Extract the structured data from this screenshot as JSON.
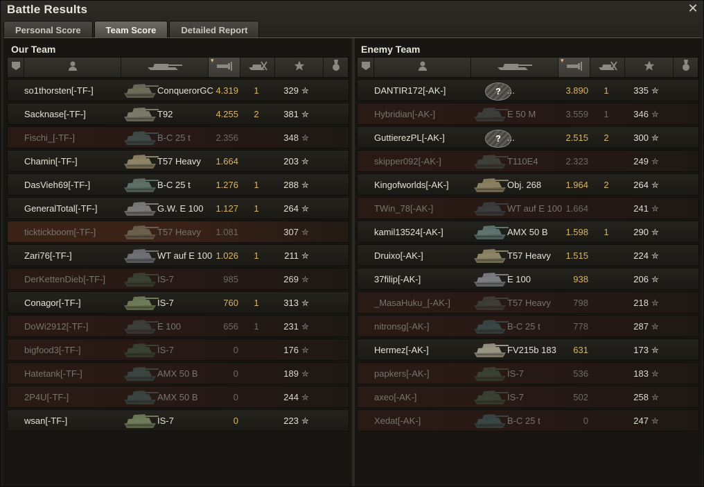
{
  "window": {
    "title": "Battle Results",
    "close_label": "✕"
  },
  "tabs": [
    {
      "label": "Personal Score",
      "active": false
    },
    {
      "label": "Team Score",
      "active": true
    },
    {
      "label": "Detailed Report",
      "active": false
    }
  ],
  "headers": {
    "icons": [
      "platoon-icon",
      "player-icon",
      "tank-icon",
      "damage-icon",
      "frags-icon",
      "xp-star-icon",
      "medal-icon"
    ],
    "sorted_column": "damage"
  },
  "our_team": {
    "title": "Our Team",
    "rows": [
      {
        "player": "so1thorsten[-TF-]",
        "tank": "ConquerorGC",
        "damage": "4.319",
        "frags": "1",
        "xp": "329",
        "alive": true,
        "tank_color": "#6d6c5a"
      },
      {
        "player": "Sacknase[-TF-]",
        "tank": "T92",
        "damage": "4.255",
        "frags": "2",
        "xp": "381",
        "alive": true,
        "tank_color": "#7b7a6a"
      },
      {
        "player": "Fischi_[-TF-]",
        "tank": "B-C 25 t",
        "damage": "2.356",
        "frags": "",
        "xp": "348",
        "alive": false,
        "tank_color": "#3e4a48"
      },
      {
        "player": "Chamin[-TF-]",
        "tank": "T57 Heavy",
        "damage": "1.664",
        "frags": "",
        "xp": "203",
        "alive": true,
        "tank_color": "#8d8466"
      },
      {
        "player": "DasVieh69[-TF-]",
        "tank": "B-C 25 t",
        "damage": "1.276",
        "frags": "1",
        "xp": "288",
        "alive": true,
        "tank_color": "#5d7068"
      },
      {
        "player": "GeneralTotal[-TF-]",
        "tank": "G.W. E 100",
        "damage": "1.127",
        "frags": "1",
        "xp": "264",
        "alive": true,
        "tank_color": "#7a7a78"
      },
      {
        "player": "ticktickboom[-TF-]",
        "tank": "T57 Heavy",
        "damage": "1.081",
        "frags": "",
        "xp": "307",
        "alive": false,
        "highlight": true,
        "tank_color": "#6a604c"
      },
      {
        "player": "Zari76[-TF-]",
        "tank": "WT auf E 100",
        "damage": "1.026",
        "frags": "1",
        "xp": "211",
        "alive": true,
        "tank_color": "#6e7074"
      },
      {
        "player": "DerKettenDieb[-TF-]",
        "tank": "IS-7",
        "damage": "985",
        "frags": "",
        "xp": "269",
        "alive": false,
        "tank_color": "#3a4034"
      },
      {
        "player": "Conagor[-TF-]",
        "tank": "IS-7",
        "damage": "760",
        "frags": "1",
        "xp": "313",
        "alive": true,
        "tank_color": "#6e7a58"
      },
      {
        "player": "DoWi2912[-TF-]",
        "tank": "E 100",
        "damage": "656",
        "frags": "1",
        "xp": "231",
        "alive": false,
        "tank_color": "#3c3e3c"
      },
      {
        "player": "bigfood3[-TF-]",
        "tank": "IS-7",
        "damage": "0",
        "frags": "",
        "xp": "176",
        "alive": false,
        "tank_color": "#394034"
      },
      {
        "player": "Hatetank[-TF-]",
        "tank": "AMX 50 B",
        "damage": "0",
        "frags": "",
        "xp": "189",
        "alive": false,
        "tank_color": "#3a4440"
      },
      {
        "player": "2P4U[-TF-]",
        "tank": "AMX 50 B",
        "damage": "0",
        "frags": "",
        "xp": "244",
        "alive": false,
        "tank_color": "#3a4440"
      },
      {
        "player": "wsan[-TF-]",
        "tank": "IS-7",
        "damage": "0",
        "frags": "",
        "xp": "223",
        "alive": true,
        "tank_color": "#6e7a58"
      }
    ]
  },
  "enemy_team": {
    "title": "Enemy Team",
    "rows": [
      {
        "player": "DANTIR172[-AK-]",
        "tank": "...",
        "damage": "3.890",
        "frags": "1",
        "xp": "335",
        "alive": true,
        "unknown": true,
        "unknown_label": "?"
      },
      {
        "player": "Hybridian[-AK-]",
        "tank": "E 50 M",
        "damage": "3.559",
        "frags": "1",
        "xp": "346",
        "alive": false,
        "tank_color": "#3c3e3c"
      },
      {
        "player": "GuttierezPL[-AK-]",
        "tank": "...",
        "damage": "2.515",
        "frags": "2",
        "xp": "300",
        "alive": true,
        "unknown": true,
        "unknown_label": "?"
      },
      {
        "player": "skipper092[-AK-]",
        "tank": "T110E4",
        "damage": "2.323",
        "frags": "",
        "xp": "249",
        "alive": false,
        "tank_color": "#3e3f38"
      },
      {
        "player": "Kingofworlds[-AK-]",
        "tank": "Obj. 268",
        "damage": "1.964",
        "frags": "2",
        "xp": "264",
        "alive": true,
        "tank_color": "#8a8060"
      },
      {
        "player": "TWin_78[-AK-]",
        "tank": "WT auf E 100",
        "damage": "1.664",
        "frags": "",
        "xp": "241",
        "alive": false,
        "tank_color": "#3a3c3e"
      },
      {
        "player": "kamil13524[-AK-]",
        "tank": "AMX 50 B",
        "damage": "1.598",
        "frags": "1",
        "xp": "290",
        "alive": true,
        "tank_color": "#5e7470"
      },
      {
        "player": "Druixo[-AK-]",
        "tank": "T57 Heavy",
        "damage": "1.515",
        "frags": "",
        "xp": "224",
        "alive": true,
        "tank_color": "#8d8466"
      },
      {
        "player": "37filip[-AK-]",
        "tank": "E 100",
        "damage": "938",
        "frags": "",
        "xp": "206",
        "alive": true,
        "tank_color": "#7a7c80"
      },
      {
        "player": "_MasaHuku_[-AK-]",
        "tank": "T57 Heavy",
        "damage": "798",
        "frags": "",
        "xp": "218",
        "alive": false,
        "tank_color": "#3e3c34"
      },
      {
        "player": "nitronsg[-AK-]",
        "tank": "B-C 25 t",
        "damage": "778",
        "frags": "",
        "xp": "287",
        "alive": false,
        "tank_color": "#3a4644"
      },
      {
        "player": "Hermez[-AK-]",
        "tank": "FV215b 183",
        "damage": "631",
        "frags": "",
        "xp": "173",
        "alive": true,
        "tank_color": "#9a9482"
      },
      {
        "player": "papkers[-AK-]",
        "tank": "IS-7",
        "damage": "536",
        "frags": "",
        "xp": "183",
        "alive": false,
        "tank_color": "#394034"
      },
      {
        "player": "axeo[-AK-]",
        "tank": "IS-7",
        "damage": "502",
        "frags": "",
        "xp": "258",
        "alive": false,
        "tank_color": "#394034"
      },
      {
        "player": "Xedat[-AK-]",
        "tank": "B-C 25 t",
        "damage": "0",
        "frags": "",
        "xp": "247",
        "alive": false,
        "tank_color": "#3a4644"
      }
    ]
  },
  "star_glyph": "✮"
}
